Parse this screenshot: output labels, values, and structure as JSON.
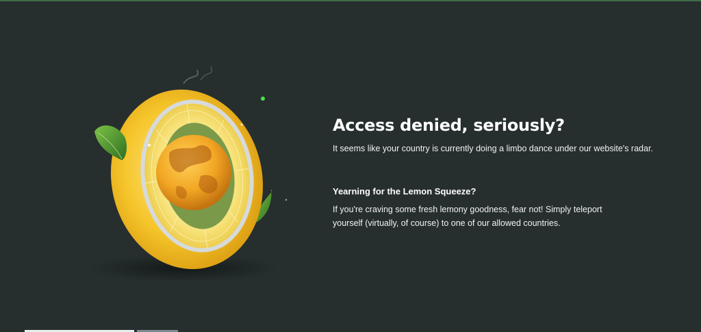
{
  "page": {
    "headline": "Access denied, seriously?",
    "subtext": "It seems like your country is currently doing a limbo dance under our website's radar.",
    "subheading": "Yearning for the Lemon Squeeze?",
    "body": "If you're craving some fresh lemony goodness, fear not! Simply teleport yourself (virtually, of course) to one of our allowed countries."
  },
  "illustration": {
    "icon": "lemon-globe-illustration",
    "colors": {
      "lemon": "#f2c12e",
      "ring": "#c9cfd2",
      "leaf": "#3f8d2c",
      "background": "#262e2e"
    }
  }
}
